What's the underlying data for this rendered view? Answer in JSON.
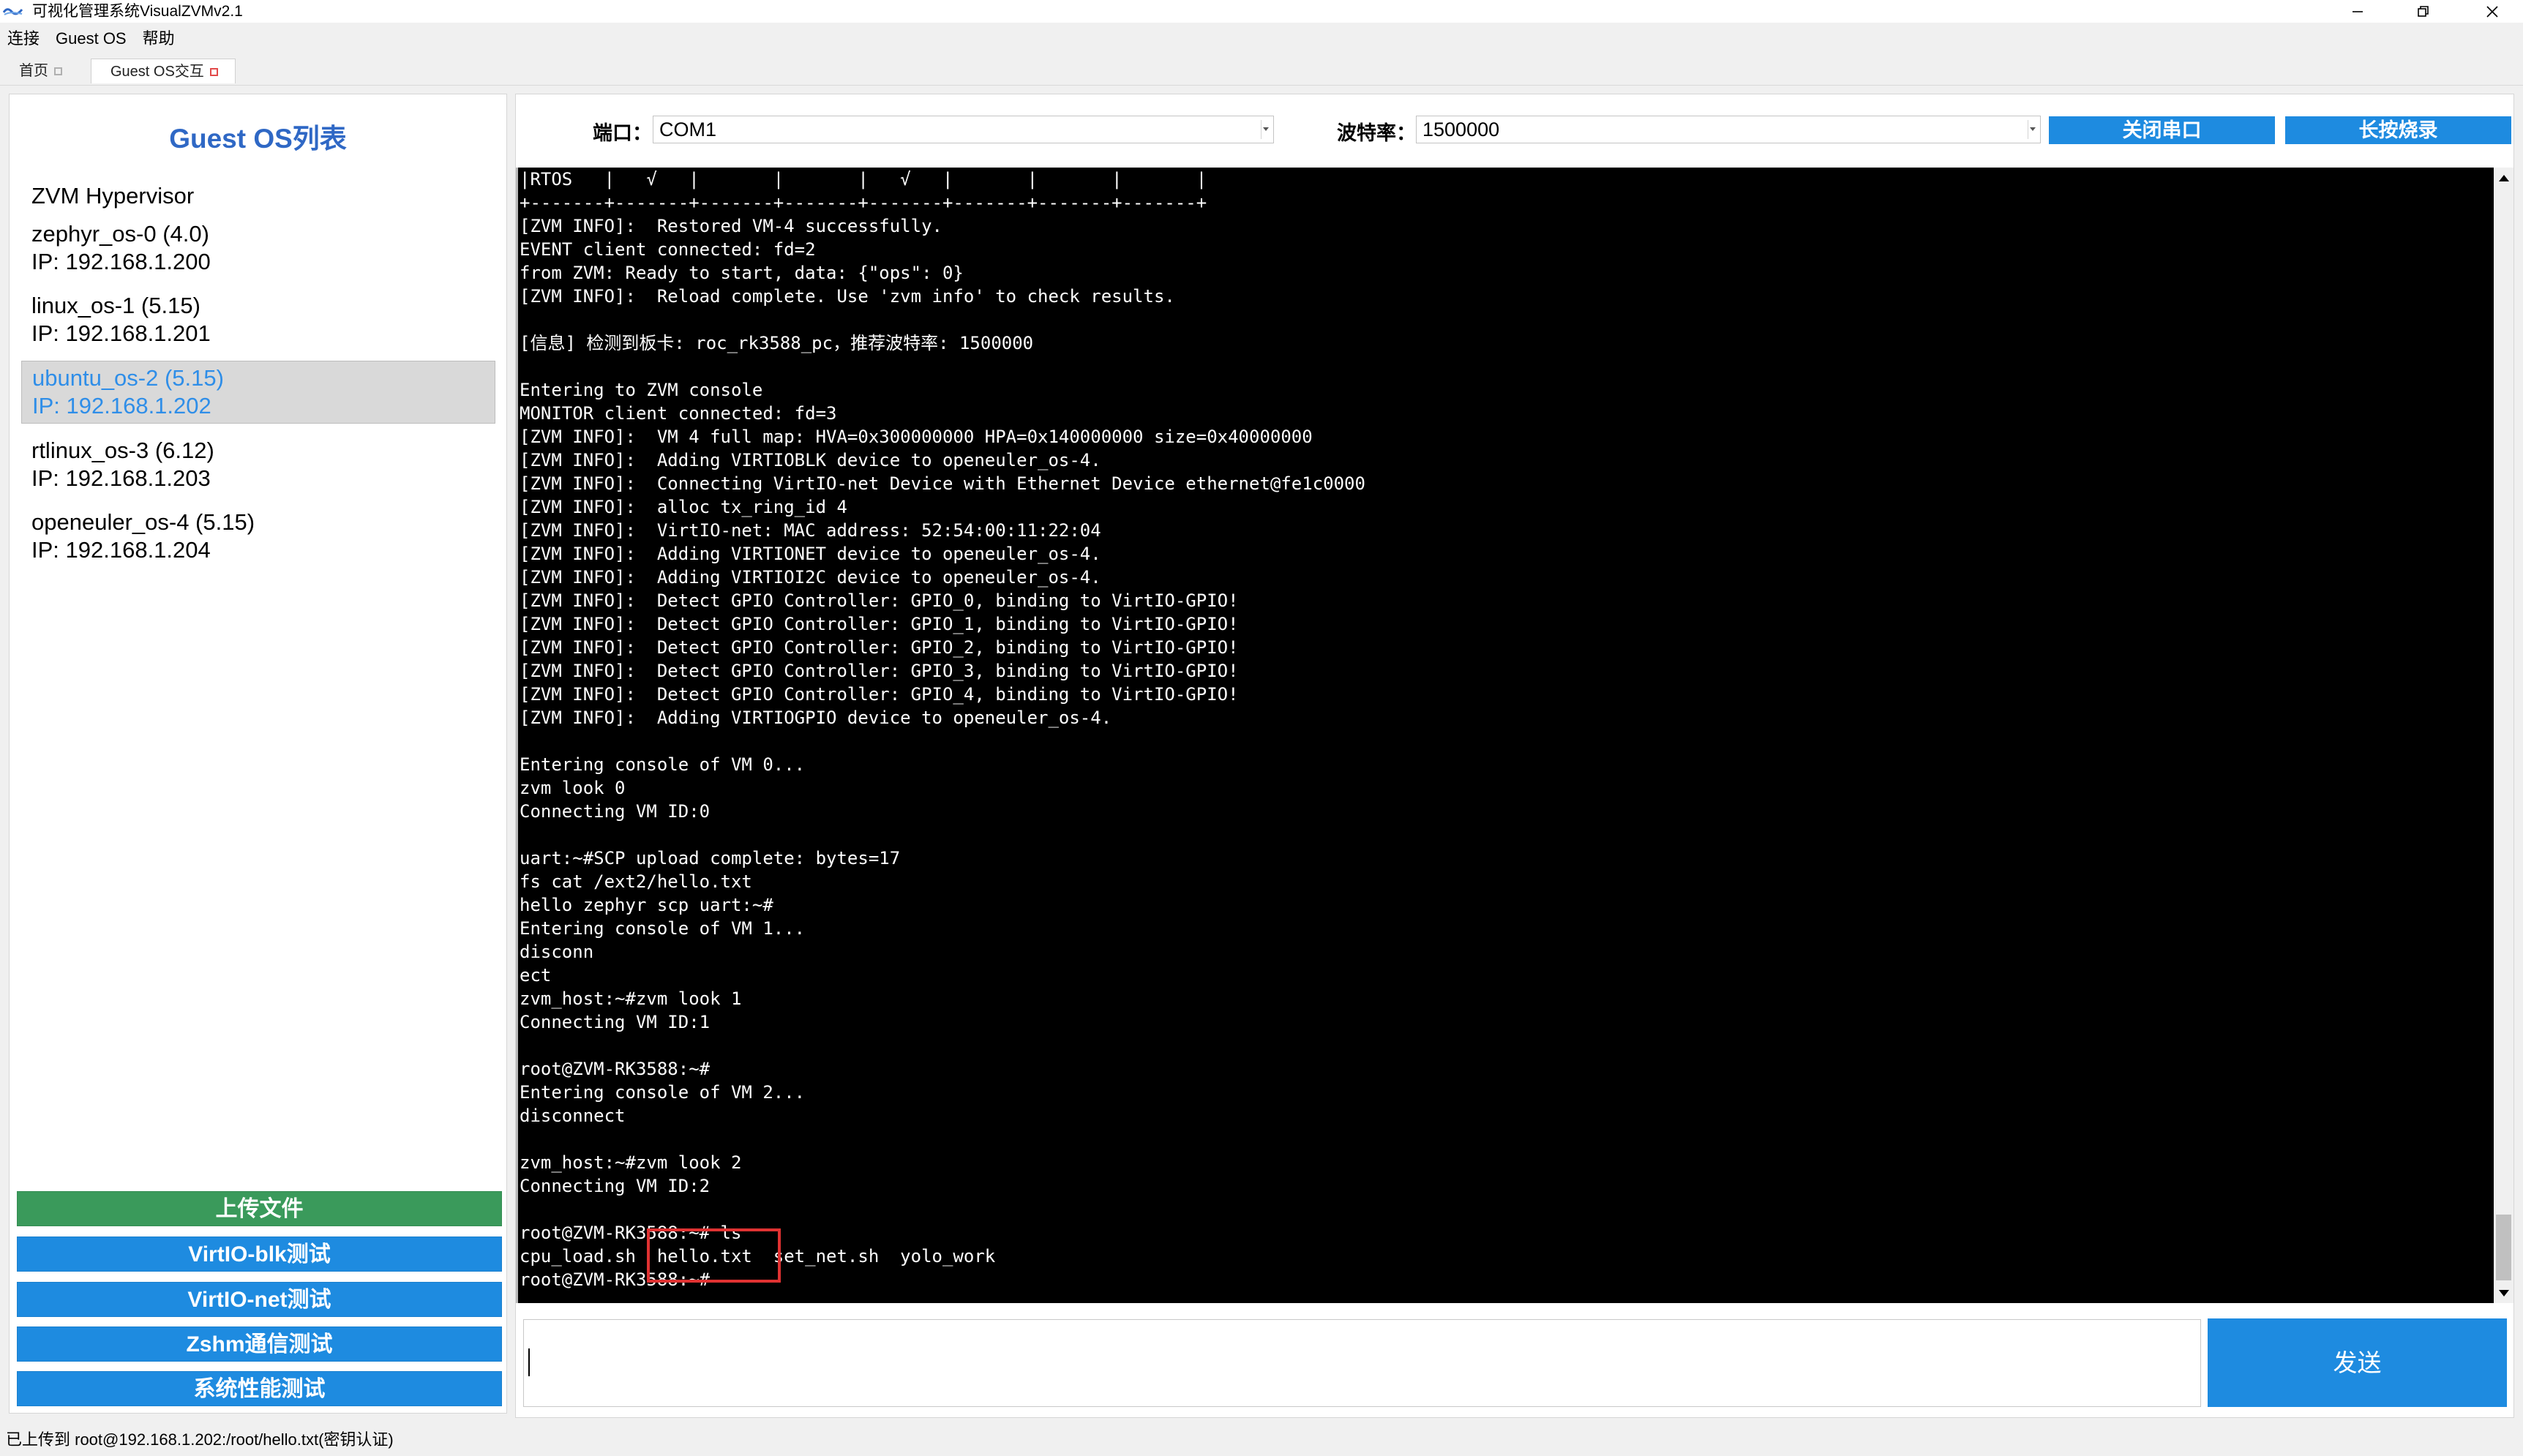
{
  "window": {
    "title": "可视化管理系统VisualZVMv2.1",
    "icons": [
      "app-logo-icon",
      "minimize-icon",
      "restore-icon",
      "close-icon"
    ]
  },
  "menu": [
    "连接",
    "Guest OS",
    "帮助"
  ],
  "tabs": [
    {
      "label": "首页",
      "active": false
    },
    {
      "label": "Guest OS交互",
      "active": true
    }
  ],
  "sidebar": {
    "title": "Guest OS列表",
    "items": [
      {
        "name": "ZVM Hypervisor",
        "ip": ""
      },
      {
        "name": "zephyr_os-0 (4.0)",
        "ip": "IP: 192.168.1.200"
      },
      {
        "name": "linux_os-1 (5.15)",
        "ip": "IP: 192.168.1.201"
      },
      {
        "name": "ubuntu_os-2 (5.15)",
        "ip": "IP: 192.168.1.202",
        "selected": true
      },
      {
        "name": "rtlinux_os-3 (6.12)",
        "ip": "IP: 192.168.1.203"
      },
      {
        "name": "openeuler_os-4 (5.15)",
        "ip": "IP: 192.168.1.204"
      }
    ],
    "buttons": [
      {
        "label": "上传文件",
        "color": "#3a9a5b"
      },
      {
        "label": "VirtIO-blk测试",
        "color": "#1e8be0"
      },
      {
        "label": "VirtIO-net测试",
        "color": "#1e8be0"
      },
      {
        "label": "Zshm通信测试",
        "color": "#1e8be0"
      },
      {
        "label": "系统性能测试",
        "color": "#1e8be0"
      }
    ]
  },
  "serial": {
    "port_label": "端口：",
    "port_value": "COM1",
    "baud_label": "波特率：",
    "baud_value": "1500000",
    "close_button": "关闭串口",
    "flash_button": "长按烧录"
  },
  "terminal": {
    "lines": [
      "|RTOS   |   √   |       |       |   √   |       |       |       |",
      "+-------+-------+-------+-------+-------+-------+-------+-------+",
      "[ZVM INFO]:  Restored VM-4 successfully.",
      "EVENT client connected: fd=2",
      "from ZVM: Ready to start, data: {\"ops\": 0}",
      "[ZVM INFO]:  Reload complete. Use 'zvm info' to check results.",
      "",
      "[信息] 检测到板卡: roc_rk3588_pc，推荐波特率: 1500000",
      "",
      "Entering to ZVM console",
      "MONITOR client connected: fd=3",
      "[ZVM INFO]:  VM 4 full map: HVA=0x300000000 HPA=0x140000000 size=0x40000000",
      "[ZVM INFO]:  Adding VIRTIOBLK device to openeuler_os-4.",
      "[ZVM INFO]:  Connecting VirtIO-net Device with Ethernet Device ethernet@fe1c0000",
      "[ZVM INFO]:  alloc tx_ring_id 4",
      "[ZVM INFO]:  VirtIO-net: MAC address: 52:54:00:11:22:04",
      "[ZVM INFO]:  Adding VIRTIONET device to openeuler_os-4.",
      "[ZVM INFO]:  Adding VIRTIOI2C device to openeuler_os-4.",
      "[ZVM INFO]:  Detect GPIO Controller: GPIO_0, binding to VirtIO-GPIO!",
      "[ZVM INFO]:  Detect GPIO Controller: GPIO_1, binding to VirtIO-GPIO!",
      "[ZVM INFO]:  Detect GPIO Controller: GPIO_2, binding to VirtIO-GPIO!",
      "[ZVM INFO]:  Detect GPIO Controller: GPIO_3, binding to VirtIO-GPIO!",
      "[ZVM INFO]:  Detect GPIO Controller: GPIO_4, binding to VirtIO-GPIO!",
      "[ZVM INFO]:  Adding VIRTIOGPIO device to openeuler_os-4.",
      "",
      "Entering console of VM 0...",
      "zvm look 0",
      "Connecting VM ID:0",
      "",
      "uart:~#SCP upload complete: bytes=17",
      "fs cat /ext2/hello.txt",
      "hello zephyr scp uart:~#",
      "Entering console of VM 1...",
      "disconn",
      "ect",
      "zvm_host:~#zvm look 1",
      "Connecting VM ID:1",
      "",
      "root@ZVM-RK3588:~#",
      "Entering console of VM 2...",
      "disconnect",
      "",
      "zvm_host:~#zvm look 2",
      "Connecting VM ID:2",
      "",
      "root@ZVM-RK3588:~# ls",
      "cpu_load.sh  hello.txt  set_net.sh  yolo_work",
      "root@ZVM-RK3588:~#"
    ]
  },
  "input": {
    "value": ""
  },
  "send_button": "发送",
  "status": "已上传到 root@192.168.1.202:/root/hello.txt(密钥认证)"
}
